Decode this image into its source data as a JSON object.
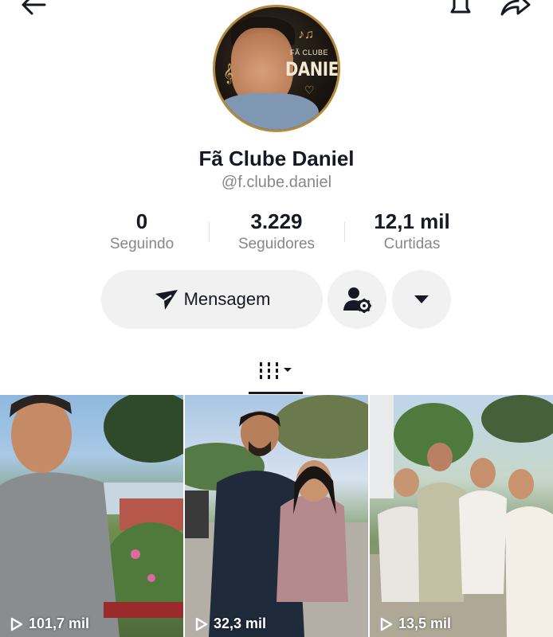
{
  "profile": {
    "display_name": "Fã Clube Daniel",
    "handle": "@f.clube.daniel",
    "avatar_text_top": "FÃ CLUBE",
    "avatar_text_name": "DANIEL"
  },
  "stats": [
    {
      "value": "0",
      "label": "Seguindo"
    },
    {
      "value": "3.229",
      "label": "Seguidores"
    },
    {
      "value": "12,1 mil",
      "label": "Curtidas"
    }
  ],
  "actions": {
    "message_label": "Mensagem"
  },
  "videos": [
    {
      "views": "101,7 mil"
    },
    {
      "views": "32,3 mil"
    },
    {
      "views": "13,5 mil"
    }
  ],
  "icons": [
    "back-arrow-icon",
    "bell-icon",
    "share-icon",
    "message-send-icon",
    "follow-settings-icon",
    "chevron-down-icon",
    "grid-icon",
    "play-icon"
  ]
}
